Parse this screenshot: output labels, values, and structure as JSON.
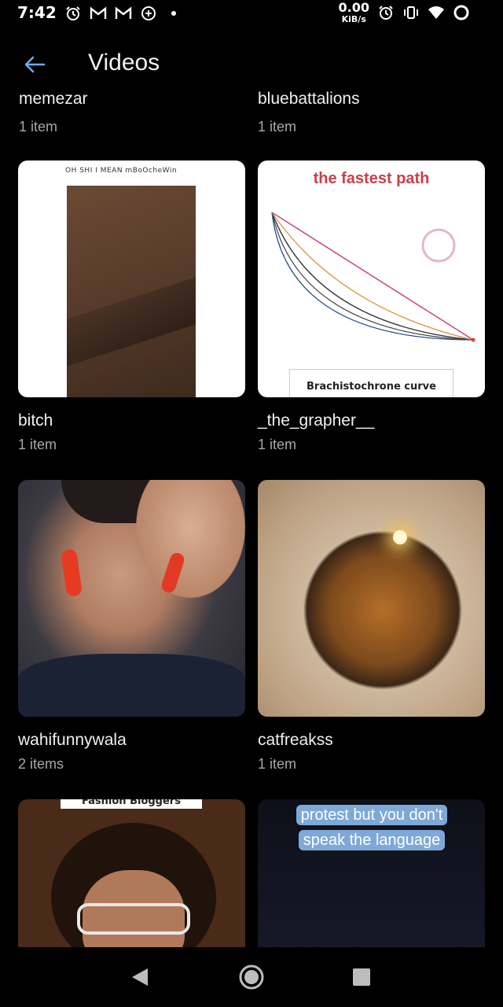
{
  "status_bar": {
    "time": "7:42",
    "net_speed_value": "0.00",
    "net_speed_unit": "KiB/s",
    "left_icons": [
      "alarm-icon",
      "gmail-icon",
      "gmail-icon",
      "messenger-icon",
      "dot-icon"
    ],
    "right_icons": [
      "alarm-icon",
      "vibrate-icon",
      "wifi-icon",
      "battery-icon"
    ]
  },
  "app_bar": {
    "title": "Videos",
    "back_icon": "arrow-left-icon"
  },
  "partial_row": [
    {
      "name": "memezar",
      "count": "1 item"
    },
    {
      "name": "bluebattalions",
      "count": "1 item"
    }
  ],
  "folders": [
    {
      "name": "bitch",
      "count": "1 item",
      "thumb_text": "OH SHI I MEAN mBoOcheWin"
    },
    {
      "name": "_the_grapher__",
      "count": "1 item",
      "thumb_title": "the fastest path",
      "thumb_caption": "Brachistochrone curve"
    },
    {
      "name": "wahifunnywala",
      "count": "2 items"
    },
    {
      "name": "catfreakss",
      "count": "1 item"
    },
    {
      "name": "",
      "count": "",
      "thumb_banner": "Fashion Bloggers"
    },
    {
      "name": "",
      "count": "",
      "thumb_caption": "protest but you don't speak the language"
    }
  ],
  "nav_bar": {
    "back": "back-triangle-icon",
    "home": "home-circle-icon",
    "recents": "recents-square-icon"
  },
  "colors": {
    "background": "#000000",
    "accent": "#6aaee8",
    "text_primary": "#f0f0f0",
    "text_secondary": "#a8a8a8"
  }
}
